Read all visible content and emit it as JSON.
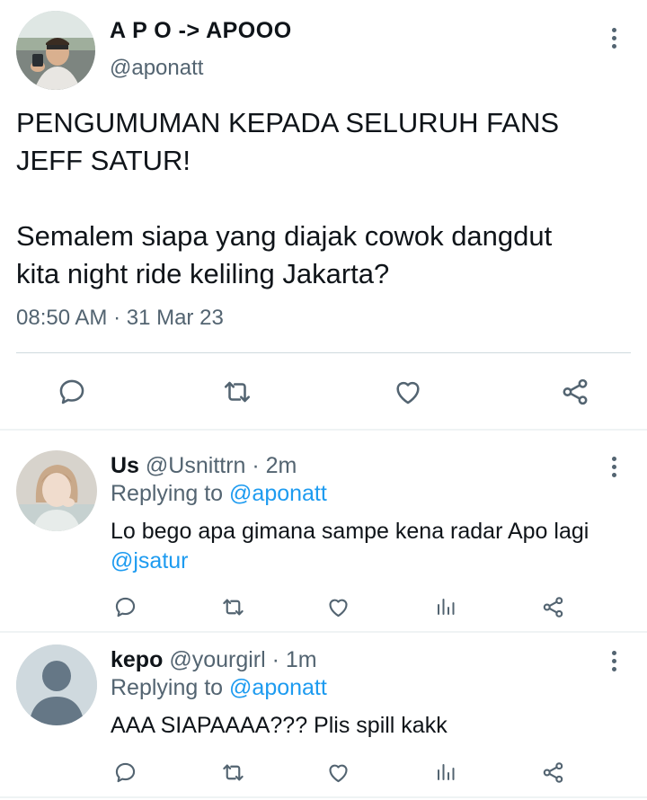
{
  "main_tweet": {
    "display_name": "A P O -> APOOO",
    "handle": "@aponatt",
    "text_line1": "PENGUMUMAN KEPADA SELURUH FANS",
    "text_line2": "JEFF SATUR!",
    "text_line3": "Semalem siapa yang diajak cowok dangdut",
    "text_line4": "kita night ride keliling Jakarta?",
    "timestamp": "08:50 AM · 31 Mar 23",
    "actions": [
      "reply-icon",
      "retweet-icon",
      "like-icon",
      "share-icon"
    ]
  },
  "replies": [
    {
      "name": "Us",
      "handle_time": "@Usnittrn · 2m",
      "replying_prefix": "Replying to",
      "replying_to": "@aponatt",
      "text": "Lo bego apa gimana sampe kena radar Apo lagi",
      "mention": "@jsatur",
      "actions": [
        "reply-icon",
        "retweet-icon",
        "like-icon",
        "analytics-icon",
        "share-icon"
      ]
    },
    {
      "name": "kepo",
      "handle_time": "@yourgirl · 1m",
      "replying_prefix": "Replying to",
      "replying_to": "@aponatt",
      "text": "AAA SIAPAAAA??? Plis spill kakk",
      "actions": [
        "reply-icon",
        "retweet-icon",
        "like-icon",
        "analytics-icon",
        "share-icon"
      ]
    }
  ],
  "colors": {
    "text_primary": "#0f1419",
    "text_secondary": "#536471",
    "link": "#1d9bf0",
    "divider": "#eff3f4"
  }
}
